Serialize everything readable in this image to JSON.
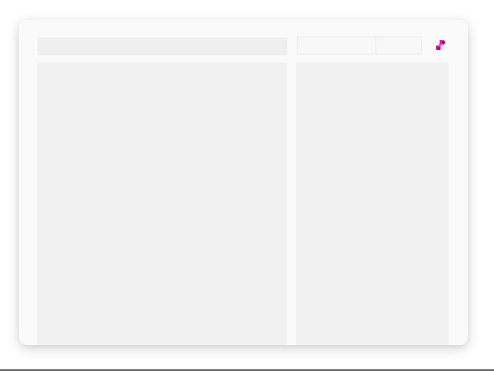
{
  "window": {
    "top_controls": {
      "segments": [
        "",
        ""
      ]
    },
    "vertical_caption": ""
  },
  "colors": {
    "accent_magenta": "#e313b8",
    "accent_magenta_dark": "#b0008d",
    "window_bg": "#fafafa",
    "panel_bg": "#f1f1f1"
  },
  "icons": {
    "logo": "magenta-shape-logo"
  }
}
